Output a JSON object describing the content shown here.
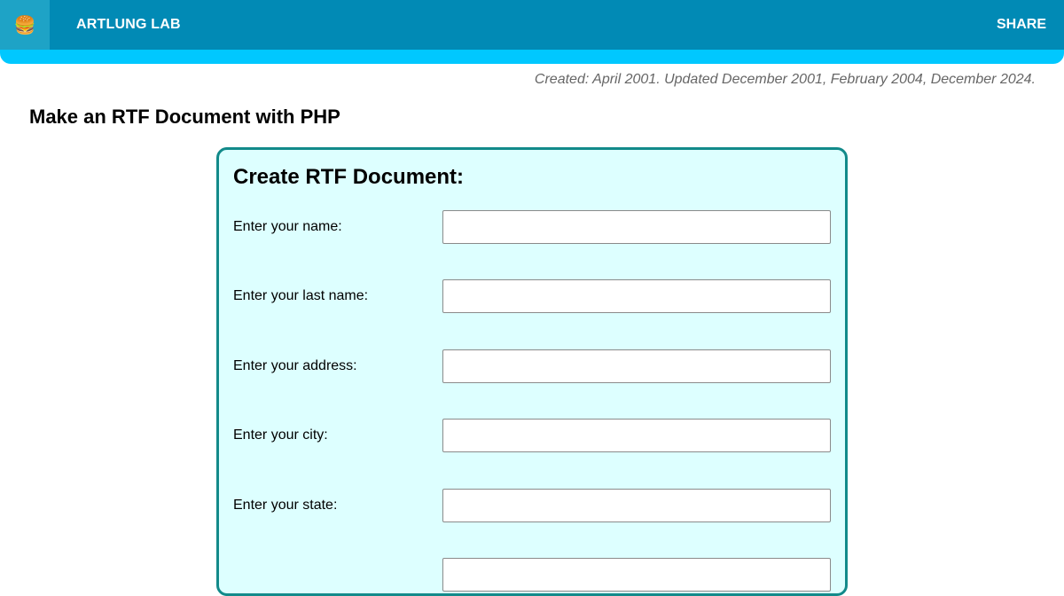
{
  "header": {
    "menu_icon": "hamburger-icon",
    "menu_glyph": "🍔",
    "site_title": "ARTLUNG LAB",
    "share_label": "SHARE"
  },
  "dates_line": "Created: April 2001. Updated December 2001, February 2004, December 2024.",
  "page_title": "Make an RTF Document with PHP",
  "form": {
    "title": "Create RTF Document:",
    "fields": [
      {
        "label": "Enter your name:",
        "value": ""
      },
      {
        "label": "Enter your last name:",
        "value": ""
      },
      {
        "label": "Enter your address:",
        "value": ""
      },
      {
        "label": "Enter your city:",
        "value": ""
      },
      {
        "label": "Enter your state:",
        "value": ""
      }
    ]
  },
  "colors": {
    "header_dark": "#018ab5",
    "header_light": "#00c8ff",
    "form_border": "#128a8a",
    "form_background": "#ddffff"
  }
}
